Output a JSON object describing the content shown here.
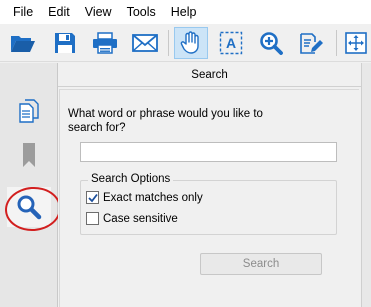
{
  "menu": [
    "File",
    "Edit",
    "View",
    "Tools",
    "Help"
  ],
  "toolbar": {
    "buttons": [
      {
        "icon": "open-folder-icon"
      },
      {
        "icon": "save-icon"
      },
      {
        "icon": "print-icon"
      },
      {
        "icon": "email-icon"
      },
      {
        "icon": "hand-tool-icon",
        "active": true
      },
      {
        "icon": "text-select-icon"
      },
      {
        "icon": "zoom-icon"
      },
      {
        "icon": "edit-icon"
      },
      {
        "icon": "fit-page-icon"
      }
    ]
  },
  "sidebar": {
    "tabs": [
      {
        "icon": "pages-icon"
      },
      {
        "icon": "bookmark-icon"
      },
      {
        "icon": "search-icon",
        "selected": true
      }
    ]
  },
  "panel": {
    "title": "Search",
    "prompt": "What word or phrase would you like to search for?",
    "search_value": "",
    "search_placeholder": "",
    "options_title": "Search Options",
    "exact_label": "Exact matches only",
    "exact_checked": true,
    "case_label": "Case sensitive",
    "case_checked": false,
    "search_button": "Search"
  },
  "colors": {
    "annotation": "#d21f1f",
    "toolbar_blue": "#1f6fc5",
    "search_icon_blue": "#2563b8"
  }
}
